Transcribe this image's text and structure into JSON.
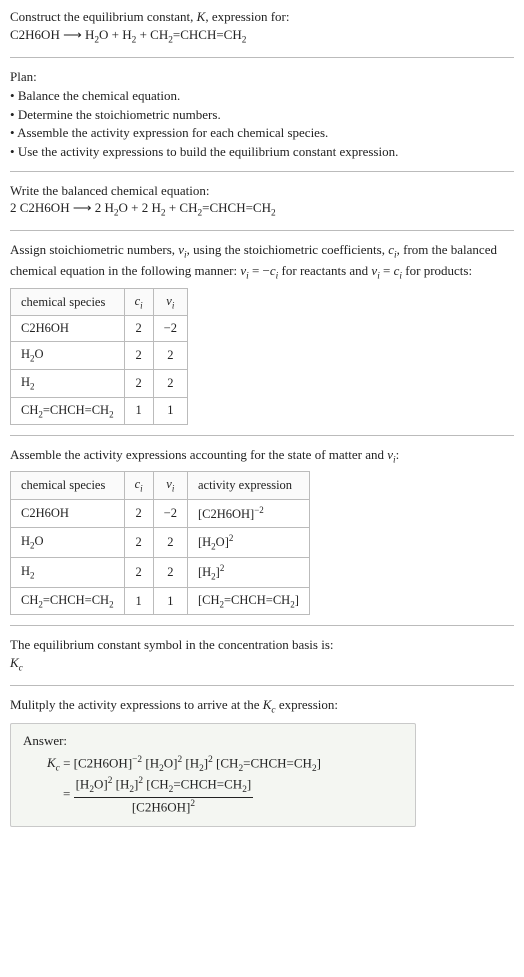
{
  "intro": {
    "line1_a": "Construct the equilibrium constant, ",
    "line1_b": ", expression for:",
    "k": "K",
    "eq_lhs": "C2H6OH",
    "arrow": " ⟶ ",
    "eq_rhs_a": "H",
    "eq_rhs_b": "O + H",
    "eq_rhs_c": " + CH",
    "eq_rhs_d": "=CHCH=CH"
  },
  "plan": {
    "title": "Plan:",
    "items": [
      "Balance the chemical equation.",
      "Determine the stoichiometric numbers.",
      "Assemble the activity expression for each chemical species.",
      "Use the activity expressions to build the equilibrium constant expression."
    ]
  },
  "balanced": {
    "title": "Write the balanced chemical equation:",
    "pre": "2 C2H6OH ⟶ 2 H",
    "mid1": "O + 2 H",
    "mid2": " + CH",
    "mid3": "=CHCH=CH"
  },
  "stoich": {
    "text_a": "Assign stoichiometric numbers, ",
    "text_b": ", using the stoichiometric coefficients, ",
    "text_c": ", from the balanced chemical equation in the following manner: ",
    "text_d": " for reactants and ",
    "text_e": " for products:",
    "nu": "ν",
    "c": "c",
    "i": "i",
    "eq1_a": " = −",
    "eq2_a": " = ",
    "headers": {
      "sp": "chemical species",
      "ci": "c",
      "vi": "ν"
    },
    "rows": [
      {
        "sp": "C2H6OH",
        "ci": "2",
        "vi": "−2"
      },
      {
        "sp_a": "H",
        "sp_b": "O",
        "ci": "2",
        "vi": "2"
      },
      {
        "sp_a": "H",
        "ci": "2",
        "vi": "2"
      },
      {
        "sp_a": "CH",
        "sp_b": "=CHCH=CH",
        "ci": "1",
        "vi": "1"
      }
    ]
  },
  "activity": {
    "text_a": "Assemble the activity expressions accounting for the state of matter and ",
    "text_b": ":",
    "headers": {
      "sp": "chemical species",
      "ci": "c",
      "vi": "ν",
      "ae": "activity expression"
    },
    "rows": [
      {
        "sp": "C2H6OH",
        "ci": "2",
        "vi": "−2",
        "ae_a": "[C2H6OH]",
        "ae_exp": "−2"
      },
      {
        "sp_a": "H",
        "sp_b": "O",
        "ci": "2",
        "vi": "2",
        "ae_a": "[H",
        "ae_b": "O]",
        "ae_exp": "2"
      },
      {
        "sp_a": "H",
        "ci": "2",
        "vi": "2",
        "ae_a": "[H",
        "ae_b": "]",
        "ae_exp": "2"
      },
      {
        "sp_a": "CH",
        "sp_b": "=CHCH=CH",
        "ci": "1",
        "vi": "1",
        "ae_a": "[CH",
        "ae_b": "=CHCH=CH",
        "ae_c": "]"
      }
    ]
  },
  "basis": {
    "line1": "The equilibrium constant symbol in the concentration basis is:",
    "k": "K",
    "c": "c"
  },
  "mult": {
    "text_a": "Mulitply the activity expressions to arrive at the ",
    "text_b": " expression:",
    "k": "K",
    "c": "c"
  },
  "answer": {
    "label": "Answer:",
    "k": "K",
    "c": "c",
    "eq": " = [C2H6OH]",
    "e1": "−2",
    "t2": " [H",
    "t3": "O]",
    "e2": "2",
    "t4": " [H",
    "t5": "]",
    "e3": "2",
    "t6": " [CH",
    "t7": "=CHCH=CH",
    "t8": "]",
    "eq2": "= ",
    "num_a": "[H",
    "num_b": "O]",
    "num_e1": "2",
    "num_c": " [H",
    "num_d": "]",
    "num_e2": "2",
    "num_e": " [CH",
    "num_f": "=CHCH=CH",
    "num_g": "]",
    "den_a": "[C2H6OH]",
    "den_e": "2"
  }
}
